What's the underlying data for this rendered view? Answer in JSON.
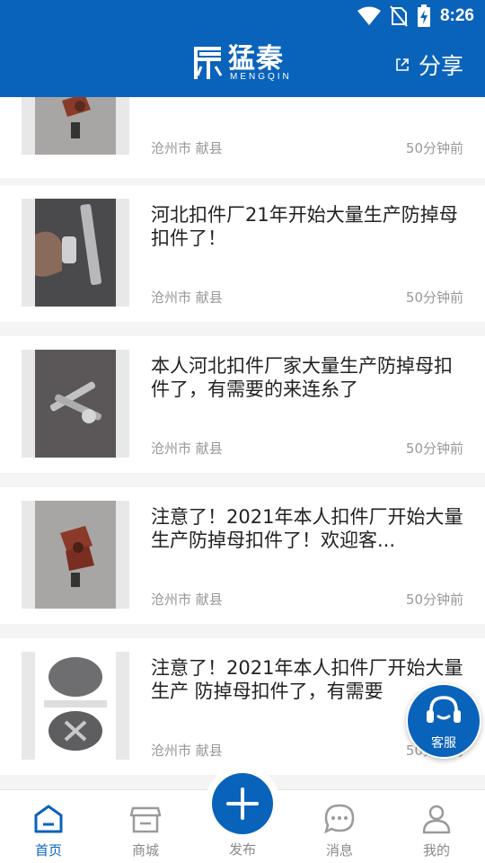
{
  "status_bar": {
    "time": "8:26",
    "icons": [
      "wifi-icon",
      "no-sim-icon",
      "battery-charging-icon"
    ]
  },
  "header": {
    "brand_name": "猛秦",
    "brand_sub": "MENGQIN",
    "share_label": "分享",
    "share_icon": "external-link-icon",
    "background": "#0a63ba"
  },
  "feed": {
    "items": [
      {
        "title": "",
        "location": "沧州市 献县",
        "time": "50分钟前"
      },
      {
        "title": "河北扣件厂21年开始大量生产防掉母扣件了！",
        "location": "沧州市 献县",
        "time": "50分钟前"
      },
      {
        "title": "本人河北扣件厂家大量生产防掉母扣件了，有需要的来连糸了",
        "location": "沧州市 献县",
        "time": "50分钟前"
      },
      {
        "title": "注意了！2021年本人扣件厂开始大量生产防掉母扣件了！欢迎客...",
        "location": "沧州市 献县",
        "time": "50分钟前"
      },
      {
        "title": "注意了！2021年本人扣件厂开始大量生产 防掉母扣件了，有需要",
        "location": "沧州市 献县",
        "time": "50分钟前"
      }
    ]
  },
  "floating": {
    "kefu_label": "客服",
    "icon": "headset-icon"
  },
  "bottom_nav": {
    "items": [
      {
        "label": "首页",
        "icon": "home-icon",
        "active": true
      },
      {
        "label": "商城",
        "icon": "store-icon",
        "active": false
      },
      {
        "label": "发布",
        "icon": "plus-icon",
        "active": false
      },
      {
        "label": "消息",
        "icon": "chat-icon",
        "active": false
      },
      {
        "label": "我的",
        "icon": "user-icon",
        "active": false
      }
    ],
    "active_color": "#0a63ba",
    "inactive_color": "#8a8a8a"
  }
}
